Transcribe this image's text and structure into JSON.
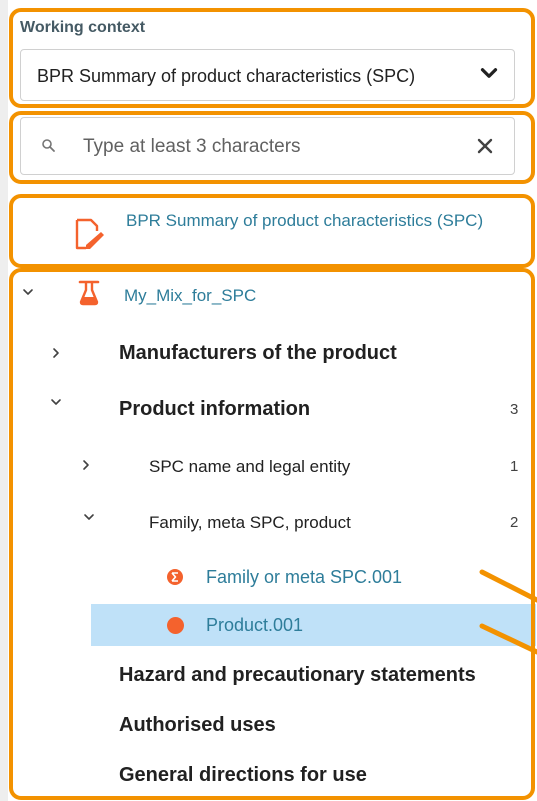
{
  "working_context": {
    "title": "Working context",
    "selected": "BPR Summary of product characteristics (SPC)"
  },
  "search": {
    "placeholder": "Type at least 3 characters"
  },
  "document": {
    "label": "BPR Summary of product characteristics (SPC)"
  },
  "tree": {
    "mix_label": "My_Mix_for_SPC",
    "items": [
      {
        "label": "Manufacturers of the product",
        "count": "",
        "expanded": false
      },
      {
        "label": "Product information",
        "count": "3",
        "expanded": true
      },
      {
        "label": "SPC name and legal entity",
        "count": "1",
        "expanded": false
      },
      {
        "label": "Family, meta SPC, product",
        "count": "2",
        "expanded": true
      },
      {
        "label": "Family or meta SPC.001",
        "count": ""
      },
      {
        "label": "Product.001",
        "count": ""
      },
      {
        "label": "Hazard and precautionary statements",
        "count": ""
      },
      {
        "label": "Authorised uses",
        "count": ""
      },
      {
        "label": "General directions for use",
        "count": ""
      }
    ]
  },
  "colors": {
    "highlight": "#f39200",
    "link": "#2e7d9a",
    "selection": "#bfe1f8",
    "status_orange": "#f4622d"
  }
}
